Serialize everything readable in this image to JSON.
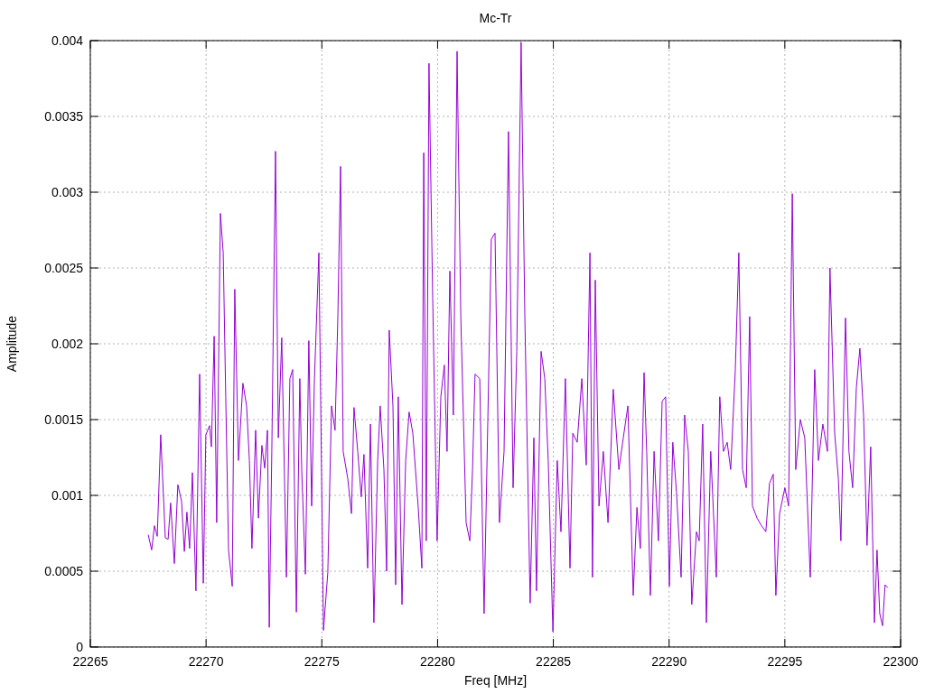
{
  "chart_data": {
    "type": "line",
    "grid": true,
    "title": "Mc-Tr",
    "xlabel": "Freq [MHz]",
    "ylabel": "Amplitude",
    "xlim": [
      22265,
      22300
    ],
    "ylim": [
      0,
      0.004
    ],
    "xticks": [
      22265,
      22270,
      22275,
      22280,
      22285,
      22290,
      22295,
      22300
    ],
    "yticks": [
      0,
      0.0005,
      0.001,
      0.0015,
      0.002,
      0.0025,
      0.003,
      0.0035,
      0.004
    ],
    "x": [
      22267.5,
      22267.65,
      22267.77,
      22267.89,
      22268.04,
      22268.24,
      22268.36,
      22268.47,
      22268.63,
      22268.78,
      22268.94,
      22269.06,
      22269.17,
      22269.29,
      22269.41,
      22269.56,
      22269.72,
      22269.88,
      22269.99,
      22270.15,
      22270.23,
      22270.35,
      22270.46,
      22270.62,
      22270.74,
      22270.85,
      22270.97,
      22271.13,
      22271.24,
      22271.4,
      22271.59,
      22271.75,
      22271.87,
      22271.98,
      22272.14,
      22272.26,
      22272.41,
      22272.53,
      22272.65,
      22272.73,
      22272.84,
      22273,
      22273.12,
      22273.27,
      22273.47,
      22273.62,
      22273.74,
      22273.9,
      22274.05,
      22274.13,
      22274.29,
      22274.44,
      22274.56,
      22274.68,
      22274.87,
      22275.07,
      22275.26,
      22275.42,
      22275.57,
      22275.69,
      22275.81,
      22275.92,
      22276.12,
      22276.28,
      22276.39,
      22276.55,
      22276.7,
      22276.82,
      22276.98,
      22277.1,
      22277.25,
      22277.41,
      22277.52,
      22277.68,
      22277.8,
      22277.91,
      22278.07,
      22278.19,
      22278.3,
      22278.46,
      22278.62,
      22278.77,
      22278.93,
      22279.16,
      22279.32,
      22279.4,
      22279.51,
      22279.63,
      22279.79,
      22279.98,
      22280.14,
      22280.29,
      22280.41,
      22280.53,
      22280.68,
      22280.84,
      22281,
      22281.23,
      22281.39,
      22281.51,
      22281.62,
      22281.82,
      22282.01,
      22282.32,
      22282.48,
      22282.67,
      22282.87,
      22283.06,
      22283.26,
      22283.42,
      22283.61,
      22283.77,
      22284,
      22284.16,
      22284.27,
      22284.47,
      22284.63,
      22284.78,
      22284.98,
      22285.17,
      22285.33,
      22285.52,
      22285.72,
      22285.84,
      22286.03,
      22286.23,
      22286.42,
      22286.58,
      22286.69,
      22286.81,
      22286.97,
      22287.16,
      22287.36,
      22287.59,
      22287.83,
      22288.02,
      22288.22,
      22288.45,
      22288.61,
      22288.76,
      22288.92,
      22289.03,
      22289.19,
      22289.35,
      22289.54,
      22289.7,
      22289.85,
      22290.01,
      22290.16,
      22290.32,
      22290.52,
      22290.67,
      22290.83,
      22290.98,
      22291.18,
      22291.3,
      22291.45,
      22291.61,
      22291.8,
      22292.04,
      22292.19,
      22292.35,
      22292.51,
      22292.66,
      22292.86,
      22293.01,
      22293.17,
      22293.33,
      22293.48,
      22293.6,
      22293.8,
      22293.99,
      22294.18,
      22294.34,
      22294.5,
      22294.61,
      22294.77,
      22295,
      22295.16,
      22295.32,
      22295.47,
      22295.67,
      22295.86,
      22296.1,
      22296.29,
      22296.45,
      22296.64,
      22296.84,
      22296.95,
      22297.15,
      22297.31,
      22297.42,
      22297.62,
      22297.77,
      22297.93,
      22298.09,
      22298.24,
      22298.4,
      22298.55,
      22298.71,
      22298.87,
      22298.98,
      22299.1,
      22299.22,
      22299.33,
      22299.45
    ],
    "series": [
      {
        "color": "#9400d3",
        "values": [
          0.00074,
          0.00064,
          0.0008,
          0.00073,
          0.0014,
          0.00072,
          0.00071,
          0.00095,
          0.00055,
          0.00107,
          0.00096,
          0.00063,
          0.00089,
          0.00065,
          0.00115,
          0.00037,
          0.0018,
          0.00042,
          0.0014,
          0.00146,
          0.00132,
          0.00205,
          0.00082,
          0.00286,
          0.0026,
          0.00165,
          0.00064,
          0.0004,
          0.00236,
          0.00123,
          0.00174,
          0.00159,
          0.00123,
          0.00065,
          0.00143,
          0.00085,
          0.00133,
          0.00118,
          0.00143,
          0.00013,
          0.00129,
          0.00327,
          0.00138,
          0.00204,
          0.00046,
          0.00177,
          0.00183,
          0.00023,
          0.00177,
          0.00117,
          0.00048,
          0.00202,
          0.00093,
          0.00177,
          0.0026,
          0.00011,
          0.00049,
          0.00159,
          0.00143,
          0.00218,
          0.00317,
          0.00129,
          0.00111,
          0.00088,
          0.00158,
          0.00129,
          0.00099,
          0.00127,
          0.00052,
          0.00147,
          0.00016,
          0.00123,
          0.00159,
          0.00117,
          0.0005,
          0.00209,
          0.00159,
          0.00041,
          0.00165,
          0.00028,
          0.00123,
          0.00155,
          0.00141,
          0.00093,
          0.00052,
          0.00326,
          0.0007,
          0.00385,
          0.0023,
          0.0007,
          0.00165,
          0.00186,
          0.00129,
          0.00248,
          0.00153,
          0.00393,
          0.00218,
          0.00082,
          0.0007,
          0.00117,
          0.0018,
          0.00177,
          0.00022,
          0.00269,
          0.00273,
          0.00082,
          0.00129,
          0.0034,
          0.00105,
          0.00195,
          0.00399,
          0.00218,
          0.00029,
          0.00138,
          0.00037,
          0.00195,
          0.00177,
          0.00123,
          0.0001,
          0.00123,
          0.00076,
          0.00177,
          0.00052,
          0.00141,
          0.00135,
          0.00177,
          0.0012,
          0.0026,
          0.00046,
          0.00242,
          0.00093,
          0.00129,
          0.00082,
          0.0017,
          0.00117,
          0.00138,
          0.00159,
          0.00034,
          0.00092,
          0.00065,
          0.00181,
          0.00129,
          0.00034,
          0.00129,
          0.0007,
          0.00162,
          0.00165,
          0.0004,
          0.00135,
          0.00102,
          0.00046,
          0.00153,
          0.00129,
          0.00028,
          0.00076,
          0.0007,
          0.00147,
          0.00016,
          0.00129,
          0.00046,
          0.00165,
          0.00129,
          0.00135,
          0.00117,
          0.00183,
          0.0026,
          0.00117,
          0.00105,
          0.00218,
          0.00093,
          0.00085,
          0.0008,
          0.00076,
          0.00108,
          0.00114,
          0.00034,
          0.00088,
          0.00105,
          0.00093,
          0.00299,
          0.00117,
          0.0015,
          0.00138,
          0.00046,
          0.00183,
          0.00123,
          0.00147,
          0.00129,
          0.0025,
          0.00141,
          0.00111,
          0.0007,
          0.00217,
          0.00129,
          0.00105,
          0.00171,
          0.00197,
          0.00153,
          0.00067,
          0.00132,
          0.00016,
          0.00064,
          0.00022,
          0.00014,
          0.00041,
          0.00039
        ]
      }
    ]
  }
}
